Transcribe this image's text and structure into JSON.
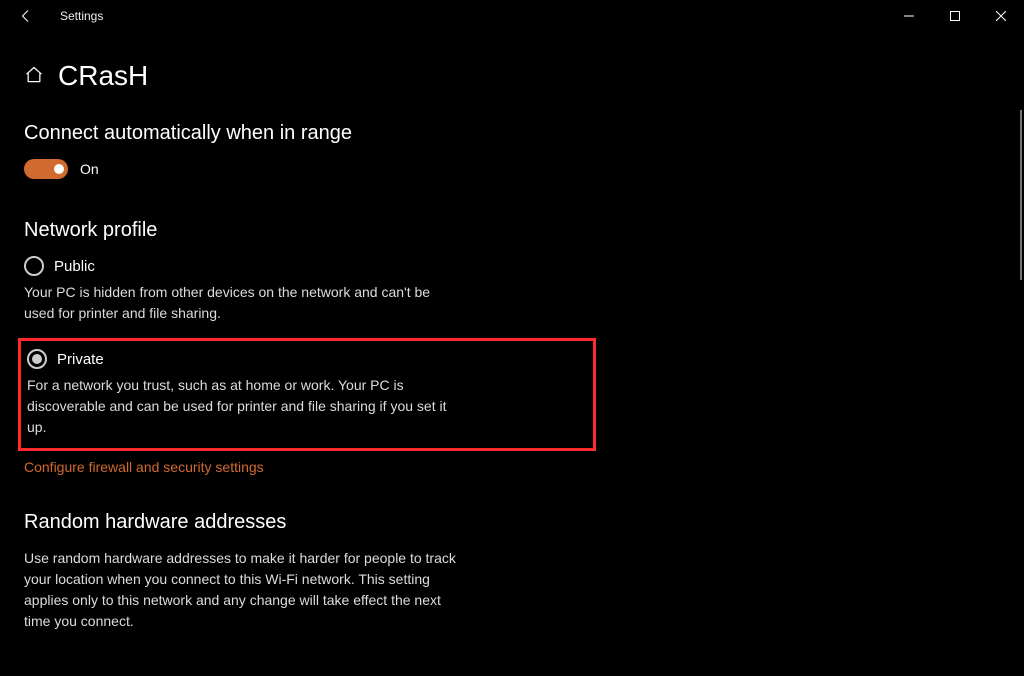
{
  "titlebar": {
    "label": "Settings"
  },
  "header": {
    "title": "CRasH"
  },
  "auto_connect": {
    "heading": "Connect automatically when in range",
    "toggle_state": "On"
  },
  "network_profile": {
    "heading": "Network profile",
    "public": {
      "label": "Public",
      "desc": "Your PC is hidden from other devices on the network and can't be used for printer and file sharing."
    },
    "private": {
      "label": "Private",
      "desc": "For a network you trust, such as at home or work. Your PC is discoverable and can be used for printer and file sharing if you set it up."
    },
    "link": "Configure firewall and security settings"
  },
  "random_hw": {
    "heading": "Random hardware addresses",
    "desc": "Use random hardware addresses to make it harder for people to track your location when you connect to this Wi-Fi network. This setting applies only to this network and any change will take effect the next time you connect."
  }
}
